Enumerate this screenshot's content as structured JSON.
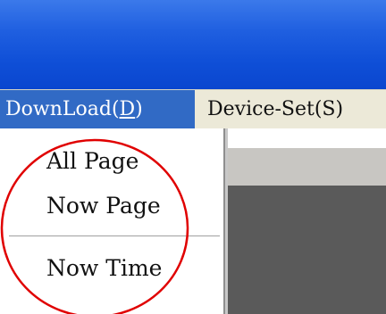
{
  "window": {
    "titlebar_color": "#0a46cf"
  },
  "menubar": {
    "items": [
      {
        "label_main": "DownLoad(",
        "label_mnemonic": "D",
        "label_end": ")",
        "active": true
      },
      {
        "label": "Device-Set(S)",
        "active": false
      }
    ],
    "active_color": "#316ac5"
  },
  "dropdown": {
    "items": [
      {
        "label": "All Page"
      },
      {
        "label": "Now Page"
      },
      {
        "label": "Now Time"
      }
    ]
  },
  "annotation": {
    "shape": "circle",
    "color": "#e00000"
  }
}
